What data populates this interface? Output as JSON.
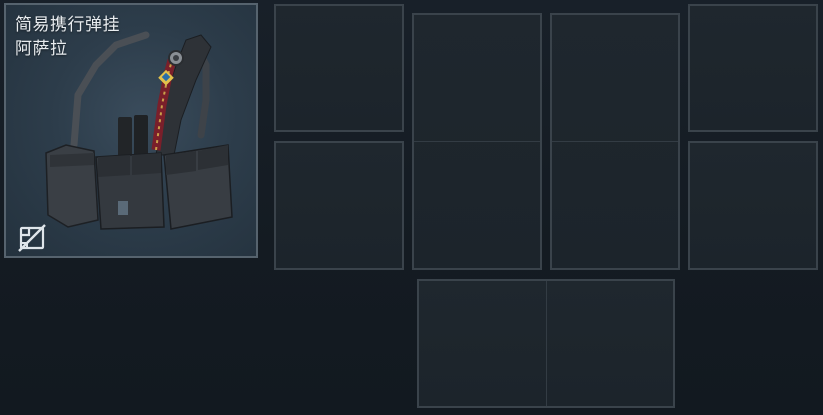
{
  "item": {
    "name_line1": "简易携行弹挂",
    "name_line2": "阿萨拉",
    "icons": {
      "no_trade": "no-trade-icon",
      "image": "chest-rig-image"
    }
  },
  "colors": {
    "background": "#161d24",
    "card_bg": "#2d3d4b",
    "card_border": "#56636e",
    "slot_border": "#3a434b",
    "slot_bg": "#1e262d",
    "title_text": "#e8ecef"
  },
  "slots": [
    {
      "id": "slot-1",
      "size": "1x1"
    },
    {
      "id": "slot-2",
      "size": "1x2"
    },
    {
      "id": "slot-3",
      "size": "1x2"
    },
    {
      "id": "slot-4",
      "size": "1x1"
    },
    {
      "id": "slot-5",
      "size": "1x1"
    },
    {
      "id": "slot-6",
      "size": "1x1"
    },
    {
      "id": "slot-7",
      "size": "2x1"
    }
  ]
}
